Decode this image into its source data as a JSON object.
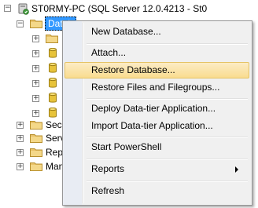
{
  "tree": {
    "server_label": "ST0RMY-PC (SQL Server 12.0.4213 - St0",
    "databases_label": "Datab",
    "child_labels": [
      "Sec",
      "Serv",
      "Rep",
      "Man"
    ]
  },
  "context_menu": {
    "items": [
      {
        "label": "New Database..."
      },
      {
        "label": "Attach..."
      },
      {
        "label": "Restore Database..."
      },
      {
        "label": "Restore Files and Filegroups..."
      },
      {
        "label": "Deploy Data-tier Application..."
      },
      {
        "label": "Import Data-tier Application..."
      },
      {
        "label": "Start PowerShell"
      },
      {
        "label": "Reports"
      },
      {
        "label": "Refresh"
      }
    ],
    "highlighted_item": "Restore Database..."
  },
  "colors": {
    "highlight": "#f9dc8f",
    "folder": "#e8c26a",
    "database": "#e7c33a",
    "server_green": "#3f9e3a"
  }
}
